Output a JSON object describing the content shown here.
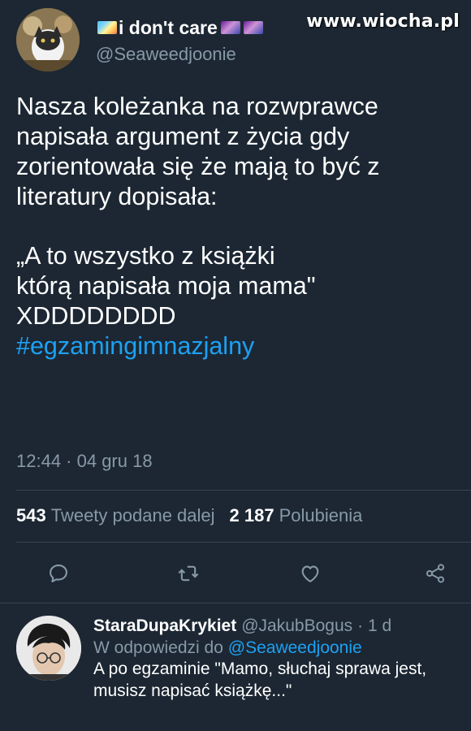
{
  "watermark": "www.wiocha.pl",
  "tweet": {
    "display_name": "i don't care",
    "handle": "@Seaweedjoonie",
    "text": "Nasza koleżanka na rozwprawce\nnapisała argument z życia gdy\nzorientowała się że mają to być z\nliteratury dopisała:\n\n„A to wszystko z książki\nktórą napisała moja mama\"\nXDDDDDDDD",
    "hashtag": "#egzamingimnazjalny",
    "timestamp": "12:44 · 04 gru 18",
    "retweets_count": "543",
    "retweets_label": "Tweety podane dalej",
    "likes_count": "2 187",
    "likes_label": "Polubienia"
  },
  "actions": {
    "reply_icon": "reply-icon",
    "retweet_icon": "retweet-icon",
    "like_icon": "heart-icon",
    "share_icon": "share-icon"
  },
  "reply": {
    "display_name": "StaraDupaKrykiet",
    "handle": "@JakubBogus",
    "time": "· 1 d",
    "in_reply_to_label": "W odpowiedzi do",
    "in_reply_to_handle": "@Seaweedjoonie",
    "text": "A po egzaminie \"Mamo, słuchaj sprawa jest, musisz napisać książkę...\""
  },
  "colors": {
    "background": "#1c2733",
    "secondary_text": "#8899a6",
    "accent": "#1da1f2",
    "divider": "#38444d"
  }
}
